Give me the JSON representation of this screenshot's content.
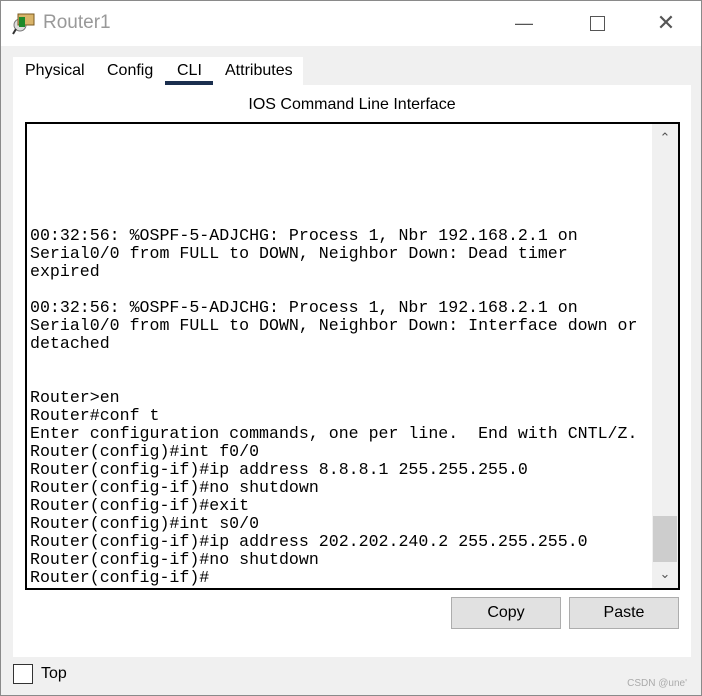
{
  "window": {
    "title": "Router1"
  },
  "tabs": [
    {
      "label": "Physical"
    },
    {
      "label": "Config"
    },
    {
      "label": "CLI",
      "active": true
    },
    {
      "label": "Attributes"
    }
  ],
  "panel": {
    "title": "IOS Command Line Interface"
  },
  "terminal": {
    "lines": [
      "00:32:56: %OSPF-5-ADJCHG: Process 1, Nbr 192.168.2.1 on",
      "Serial0/0 from FULL to DOWN, Neighbor Down: Dead timer",
      "expired",
      "",
      "00:32:56: %OSPF-5-ADJCHG: Process 1, Nbr 192.168.2.1 on",
      "Serial0/0 from FULL to DOWN, Neighbor Down: Interface down or",
      "detached",
      "",
      "",
      "Router>en",
      "Router#conf t",
      "Enter configuration commands, one per line.  End with CNTL/Z.",
      "Router(config)#int f0/0",
      "Router(config-if)#ip address 8.8.8.1 255.255.255.0",
      "Router(config-if)#no shutdown",
      "Router(config-if)#exit",
      "Router(config)#int s0/0",
      "Router(config-if)#ip address 202.202.240.2 255.255.255.0",
      "Router(config-if)#no shutdown",
      "Router(config-if)#"
    ]
  },
  "buttons": {
    "copy": "Copy",
    "paste": "Paste"
  },
  "top_checkbox": {
    "label": "Top",
    "checked": false
  },
  "watermark": "CSDN @une'",
  "colors": {
    "tab_underline": "#1a2e4e"
  }
}
